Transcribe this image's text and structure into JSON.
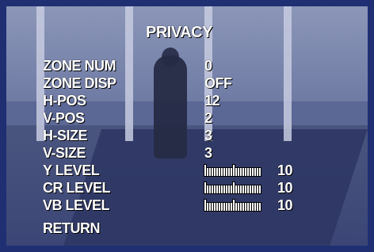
{
  "osd": {
    "title": "PRIVACY",
    "items": [
      {
        "label": "ZONE NUM",
        "value": "0"
      },
      {
        "label": "ZONE DISP",
        "value": "OFF"
      },
      {
        "label": "H-POS",
        "value": "12"
      },
      {
        "label": "V-POS",
        "value": "2"
      },
      {
        "label": "H-SIZE",
        "value": "3"
      },
      {
        "label": "V-SIZE",
        "value": "3"
      },
      {
        "label": "Y  LEVEL",
        "level": 10
      },
      {
        "label": "CR  LEVEL",
        "level": 10
      },
      {
        "label": "VB  LEVEL",
        "level": 10
      }
    ],
    "return_label": "RETURN"
  },
  "colors": {
    "frame": "#1f2f72",
    "osd_text": "#ffffff"
  }
}
